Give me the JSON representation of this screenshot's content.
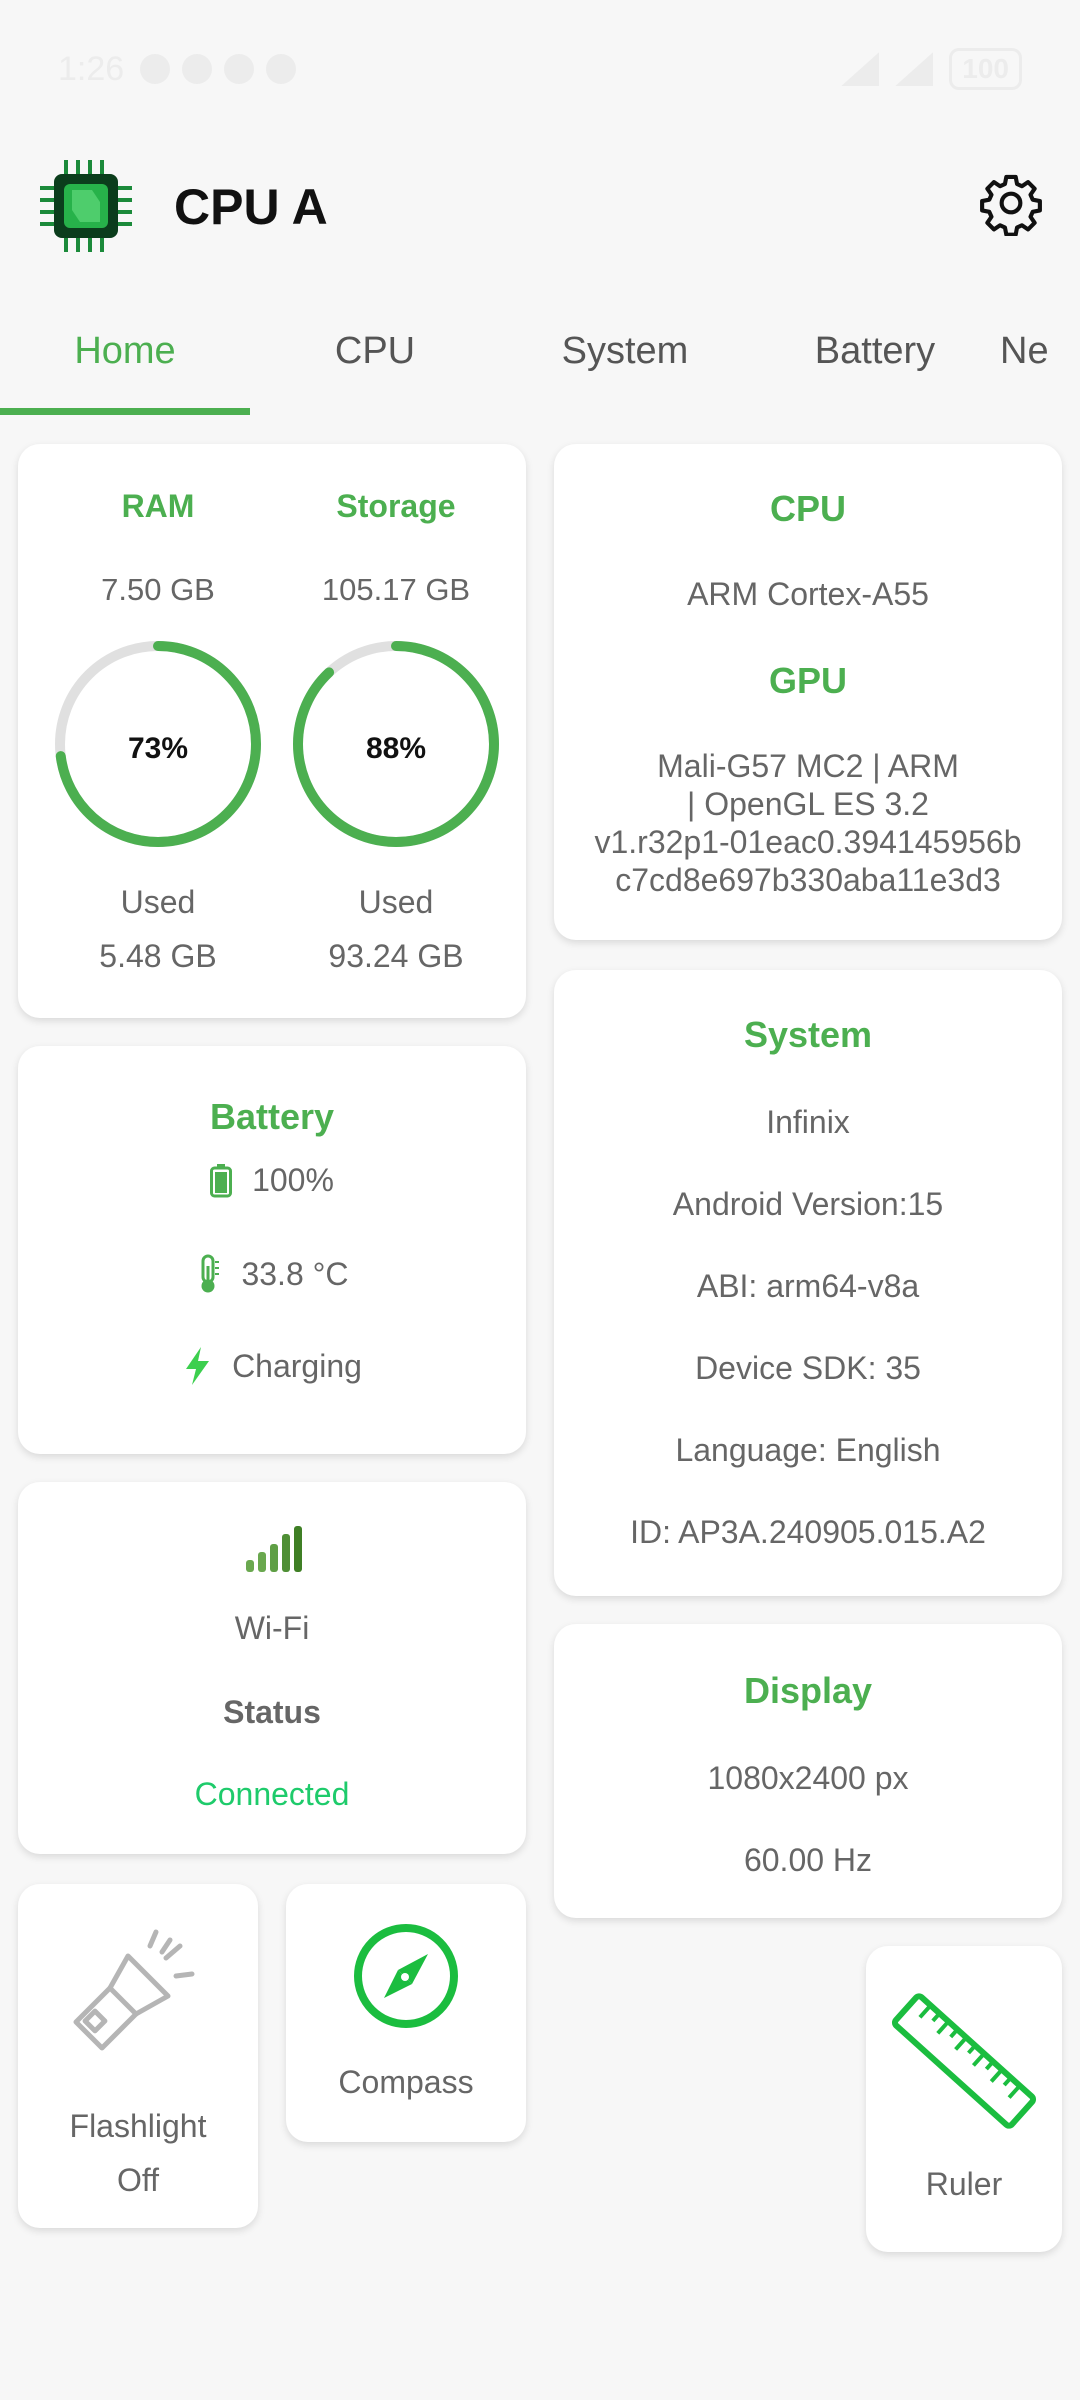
{
  "status_bar": {
    "time": "1:26",
    "battery": "100"
  },
  "header": {
    "title": "CPU A"
  },
  "tabs": [
    "Home",
    "CPU",
    "System",
    "Battery",
    "Ne"
  ],
  "memory": {
    "ram": {
      "title": "RAM",
      "total": "7.50 GB",
      "percent": "73%",
      "percent_value": 73,
      "used_label": "Used",
      "used": "5.48 GB"
    },
    "storage": {
      "title": "Storage",
      "total": "105.17 GB",
      "percent": "88%",
      "percent_value": 88,
      "used_label": "Used",
      "used": "93.24 GB"
    }
  },
  "cpu_gpu": {
    "cpu_title": "CPU",
    "cpu_value": "ARM Cortex-A55",
    "gpu_title": "GPU",
    "gpu_lines": [
      "Mali-G57 MC2 | ARM",
      "| OpenGL ES 3.2",
      "v1.r32p1-01eac0.394145956b",
      "c7cd8e697b330aba11e3d3"
    ]
  },
  "battery": {
    "title": "Battery",
    "level": "100%",
    "temperature": "33.8 °C",
    "state": "Charging"
  },
  "system": {
    "title": "System",
    "lines": [
      "Infinix",
      "Android Version:15",
      "ABI: arm64-v8a",
      "Device SDK: 35",
      "Language: English",
      "ID: AP3A.240905.015.A2"
    ]
  },
  "network": {
    "type": "Wi-Fi",
    "status_label": "Status",
    "status": "Connected"
  },
  "display": {
    "title": "Display",
    "resolution": "1080x2400 px",
    "refresh": "60.00 Hz"
  },
  "tools": {
    "flashlight": {
      "label": "Flashlight",
      "state": "Off"
    },
    "compass": {
      "label": "Compass"
    },
    "ruler": {
      "label": "Ruler"
    }
  },
  "colors": {
    "accent": "#4caf50",
    "connected": "#1ecb6b",
    "ring_track": "#e0e0e0"
  }
}
